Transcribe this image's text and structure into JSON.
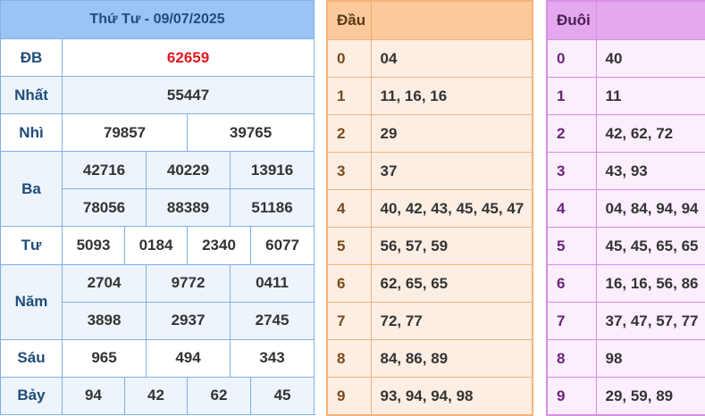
{
  "results": {
    "title": "Thứ Tư - 09/07/2025",
    "db": {
      "label": "ĐB",
      "value": "62659"
    },
    "nhat": {
      "label": "Nhất",
      "value": "55447"
    },
    "nhi": {
      "label": "Nhì",
      "values": [
        "79857",
        "39765"
      ]
    },
    "ba": {
      "label": "Ba",
      "values": [
        "42716",
        "40229",
        "13916",
        "78056",
        "88389",
        "51186"
      ]
    },
    "tu": {
      "label": "Tư",
      "values": [
        "5093",
        "0184",
        "2340",
        "6077"
      ]
    },
    "nam": {
      "label": "Năm",
      "values": [
        "2704",
        "9772",
        "0411",
        "3898",
        "2937",
        "2745"
      ]
    },
    "sau": {
      "label": "Sáu",
      "values": [
        "965",
        "494",
        "343"
      ]
    },
    "bay": {
      "label": "Bảy",
      "values": [
        "94",
        "42",
        "62",
        "45"
      ]
    }
  },
  "dau": {
    "header": "Đầu",
    "rows": [
      {
        "digit": "0",
        "numbers": "04"
      },
      {
        "digit": "1",
        "numbers": "11, 16, 16"
      },
      {
        "digit": "2",
        "numbers": "29"
      },
      {
        "digit": "3",
        "numbers": "37"
      },
      {
        "digit": "4",
        "numbers": "40, 42, 43, 45, 45, 47"
      },
      {
        "digit": "5",
        "numbers": "56, 57, 59"
      },
      {
        "digit": "6",
        "numbers": "62, 65, 65"
      },
      {
        "digit": "7",
        "numbers": "72, 77"
      },
      {
        "digit": "8",
        "numbers": "84, 86, 89"
      },
      {
        "digit": "9",
        "numbers": "93, 94, 94, 98"
      }
    ]
  },
  "duoi": {
    "header": "Đuôi",
    "rows": [
      {
        "digit": "0",
        "numbers": "40"
      },
      {
        "digit": "1",
        "numbers": "11"
      },
      {
        "digit": "2",
        "numbers": "42, 62, 72"
      },
      {
        "digit": "3",
        "numbers": "43, 93"
      },
      {
        "digit": "4",
        "numbers": "04, 84, 94, 94"
      },
      {
        "digit": "5",
        "numbers": "45, 45, 65, 65"
      },
      {
        "digit": "6",
        "numbers": "16, 16, 56, 86"
      },
      {
        "digit": "7",
        "numbers": "37, 47, 57, 77"
      },
      {
        "digit": "8",
        "numbers": "98"
      },
      {
        "digit": "9",
        "numbers": "29, 59, 89"
      }
    ]
  },
  "colors": {
    "header_blue": "#9cc3f5",
    "special_red": "#e0191f",
    "dau_orange": "#fbc99b",
    "duoi_purple": "#e3a8ee"
  }
}
